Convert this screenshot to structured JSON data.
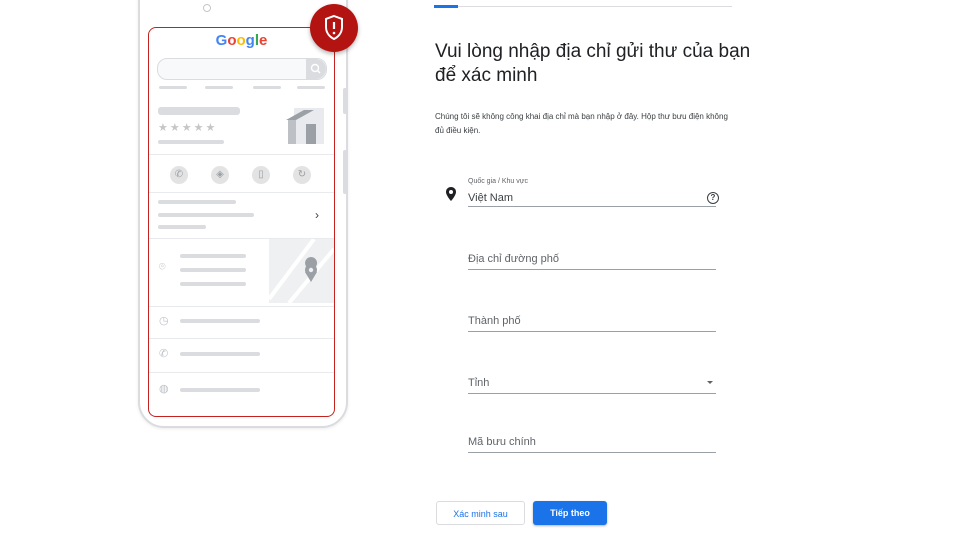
{
  "illustration": {
    "logo_parts": [
      "G",
      "o",
      "o",
      "g",
      "l",
      "e"
    ],
    "stars": "★★★★★",
    "alert_icon": "shield-alert-icon"
  },
  "form": {
    "heading": "Vui lòng nhập địa chỉ gửi thư của bạn để xác minh",
    "description": "Chúng tôi sẽ không công khai địa chỉ mà bạn nhập ở đây. Hộp thư bưu điện không đủ điều kiện.",
    "fields": {
      "country": {
        "label": "Quốc gia / Khu vực",
        "value": "Việt Nam"
      },
      "street": {
        "placeholder": "Địa chỉ đường phố"
      },
      "city": {
        "placeholder": "Thành phố"
      },
      "province": {
        "placeholder": "Tỉnh"
      },
      "postal": {
        "placeholder": "Mã bưu chính"
      }
    },
    "buttons": {
      "later": "Xác minh sau",
      "next": "Tiếp theo"
    },
    "progress": 0.08
  },
  "colors": {
    "accent": "#1a73e8",
    "alert": "#b31412"
  }
}
